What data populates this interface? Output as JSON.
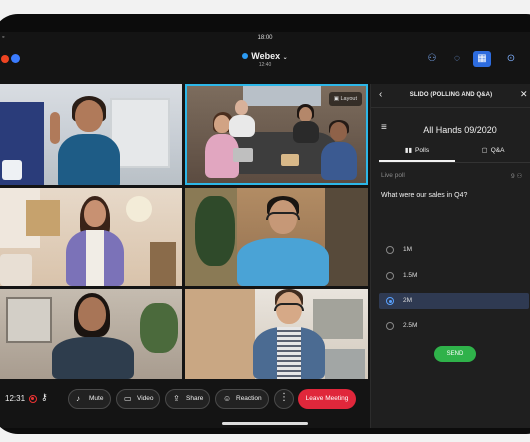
{
  "status_bar": {
    "time": "18:00"
  },
  "header": {
    "app_title": "Webex",
    "timer": "12:40",
    "icons": [
      "person-add-icon",
      "chat-icon",
      "apps-icon",
      "more-icon"
    ]
  },
  "video": {
    "layout_label": "Layout"
  },
  "controls": {
    "time": "12:31",
    "mute": "Mute",
    "video": "Video",
    "share": "Share",
    "reaction": "Reaction",
    "more": "⋮",
    "leave": "Leave Meeting"
  },
  "panel": {
    "title": "SLIDO (POLLING AND Q&A)",
    "event": "All Hands 09/2020",
    "tabs": {
      "polls": "Polls",
      "qa": "Q&A"
    },
    "live_poll": "Live poll",
    "live_count": "9",
    "question": "What were our sales in Q4?",
    "options": [
      "1M",
      "1.5M",
      "2M",
      "2.5M"
    ],
    "selected_index": 2,
    "send": "SEND"
  },
  "colors": {
    "accent": "#2d6cdf",
    "leave": "#e0273b",
    "send": "#2fb24a",
    "active_speaker": "#2db7e8"
  }
}
